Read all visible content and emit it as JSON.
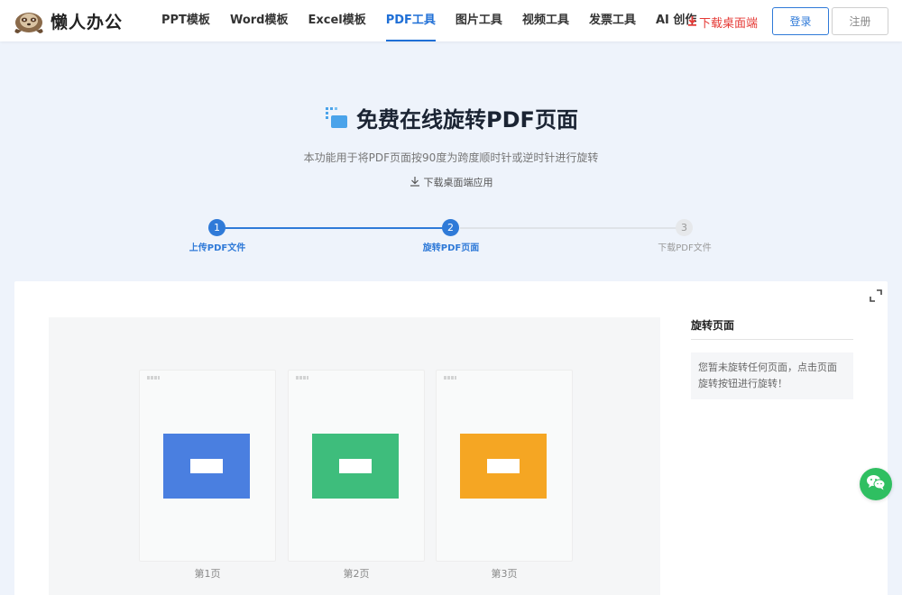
{
  "header": {
    "logo_text": "懒人办公",
    "nav": [
      {
        "label": "PPT模板",
        "active": false
      },
      {
        "label": "Word模板",
        "active": false
      },
      {
        "label": "Excel模板",
        "active": false
      },
      {
        "label": "PDF工具",
        "active": true
      },
      {
        "label": "图片工具",
        "active": false
      },
      {
        "label": "视频工具",
        "active": false
      },
      {
        "label": "发票工具",
        "active": false
      },
      {
        "label": "AI 创作",
        "active": false
      }
    ],
    "download_link": "下载桌面端",
    "login_label": "登录",
    "register_label": "注册"
  },
  "hero": {
    "title": "免费在线旋转PDF页面",
    "subtitle": "本功能用于将PDF页面按90度为跨度顺时针或逆时针进行旋转",
    "download_app": "下载桌面端应用"
  },
  "steps": [
    {
      "number": "1",
      "label": "上传PDF文件",
      "state": "done"
    },
    {
      "number": "2",
      "label": "旋转PDF页面",
      "state": "current"
    },
    {
      "number": "3",
      "label": "下载PDF文件",
      "state": "todo"
    }
  ],
  "pages": [
    {
      "label": "第1页",
      "color": "#4a7fe0"
    },
    {
      "label": "第2页",
      "color": "#3ebd7c"
    },
    {
      "label": "第3页",
      "color": "#f5a623"
    }
  ],
  "side_panel": {
    "title": "旋转页面",
    "message": "您暂未旋转任何页面，点击页面旋转按钮进行旋转！"
  },
  "colors": {
    "accent": "#2f7ad8",
    "download_red": "#e53935",
    "page_bg": "#eef3fb",
    "wechat_green": "#2fbf61"
  },
  "icons": {
    "logo": "sloth-logo-icon",
    "download": "download-arrow-icon",
    "tool": "rotate-pdf-tool-icon",
    "expand": "expand-icon",
    "wechat": "wechat-icon"
  }
}
